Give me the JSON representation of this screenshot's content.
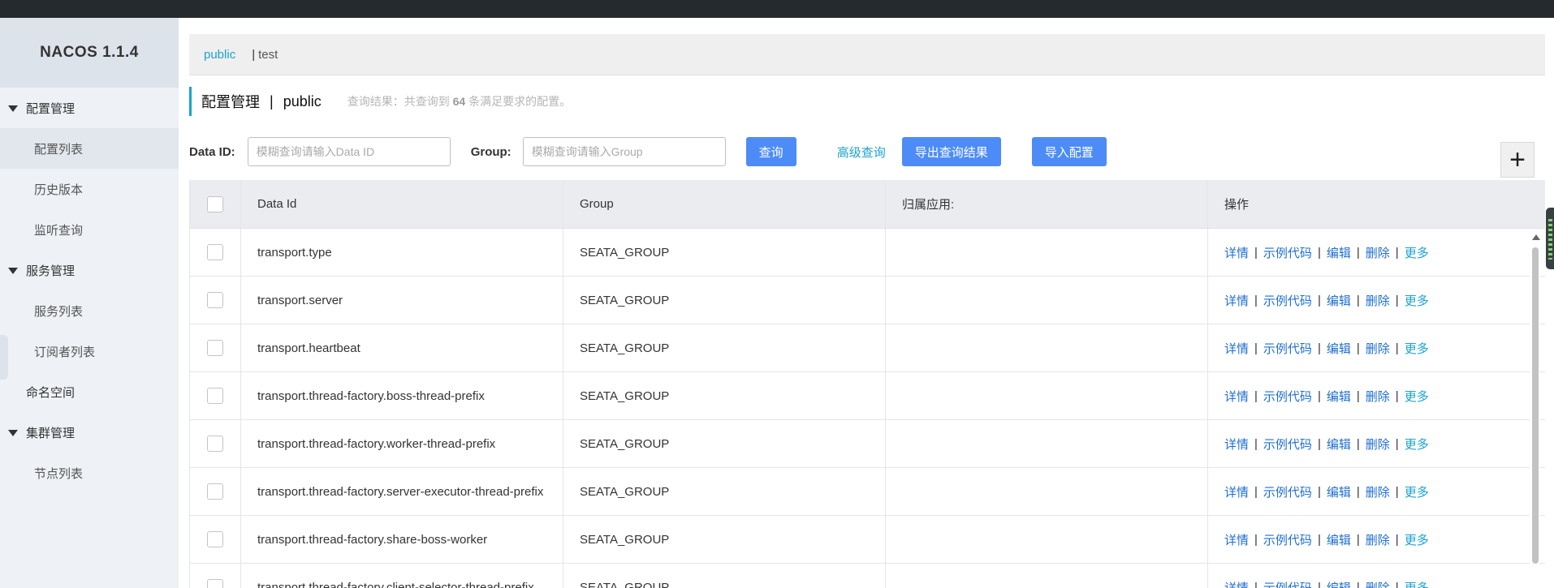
{
  "app": {
    "logo": "NACOS 1.1.4"
  },
  "sidebar": {
    "groups": [
      {
        "label": "配置管理",
        "items": [
          "配置列表",
          "历史版本",
          "监听查询"
        ]
      },
      {
        "label": "服务管理",
        "items": [
          "服务列表",
          "订阅者列表"
        ]
      },
      {
        "label": "命名空间"
      },
      {
        "label": "集群管理",
        "items": [
          "节点列表"
        ]
      }
    ]
  },
  "namespaces": {
    "active": "public",
    "separator": "|",
    "other": "test"
  },
  "page": {
    "title": "配置管理",
    "separator": "|",
    "namespace": "public",
    "hint_prefix": "查询结果：共查询到",
    "hint_count": "64",
    "hint_suffix": "条满足要求的配置。"
  },
  "search": {
    "data_id_label": "Data ID:",
    "data_id_placeholder": "模糊查询请输入Data ID",
    "group_label": "Group:",
    "group_placeholder": "模糊查询请输入Group",
    "query_button": "查询",
    "advanced_link": "高级查询",
    "export_button": "导出查询结果",
    "import_button": "导入配置",
    "add_button": "+"
  },
  "table": {
    "headers": {
      "data_id": "Data Id",
      "group": "Group",
      "app": "归属应用:",
      "ops": "操作"
    },
    "ops": {
      "detail": "详情",
      "sample": "示例代码",
      "edit": "编辑",
      "delete": "删除",
      "more": "更多",
      "sep": "|"
    },
    "rows": [
      {
        "data_id": "transport.type",
        "group": "SEATA_GROUP",
        "app": ""
      },
      {
        "data_id": "transport.server",
        "group": "SEATA_GROUP",
        "app": ""
      },
      {
        "data_id": "transport.heartbeat",
        "group": "SEATA_GROUP",
        "app": ""
      },
      {
        "data_id": "transport.thread-factory.boss-thread-prefix",
        "group": "SEATA_GROUP",
        "app": ""
      },
      {
        "data_id": "transport.thread-factory.worker-thread-prefix",
        "group": "SEATA_GROUP",
        "app": ""
      },
      {
        "data_id": "transport.thread-factory.server-executor-thread-prefix",
        "group": "SEATA_GROUP",
        "app": ""
      },
      {
        "data_id": "transport.thread-factory.share-boss-worker",
        "group": "SEATA_GROUP",
        "app": ""
      },
      {
        "data_id": "transport.thread-factory.client-selector-thread-prefix",
        "group": "SEATA_GROUP",
        "app": ""
      }
    ]
  },
  "colors": {
    "accent": "#1aa2d1",
    "primary_button": "#4d8cf7",
    "topbar": "#252a2f",
    "sidebar": "#eef1f5"
  }
}
